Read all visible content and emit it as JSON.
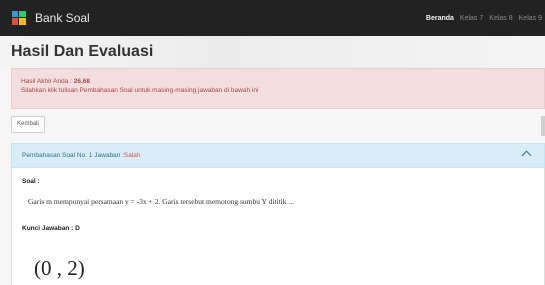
{
  "navbar": {
    "brand": "Bank Soal",
    "links": [
      "Beranda",
      "Kelas 7",
      "Kelas 8",
      "Kelas 9"
    ]
  },
  "page": {
    "title": "Hasil Dan Evaluasi"
  },
  "result": {
    "score_label": "Hasil Akhir Anda : ",
    "score_value": "26.68",
    "instruction": "Silahkan klik tulisan Pembahasan Soal untuk masing-masing jawaban di bawah ini"
  },
  "back_button": "Kembali",
  "panel": {
    "heading": "Pembahasan Soal No. 1 Jawaban :",
    "status": "Salah",
    "soal_label": "Soal :",
    "question": "Garis m mempunyai persamaan y = -3x + 2. Garis tersebut memotong sumbu Y dititik ...",
    "key_label": "Kunci Jawaban : D",
    "answer": "(0 , 2)"
  },
  "colors": {
    "navbar": "#222222",
    "alert_bg": "#f2dede",
    "alert_text": "#a94442",
    "panel_bg": "#d9edf7",
    "panel_text": "#31708f",
    "wrong": "#d9534f"
  },
  "icons": {
    "brand": "app-logo-icon",
    "toggle": "chevron-up-icon"
  }
}
